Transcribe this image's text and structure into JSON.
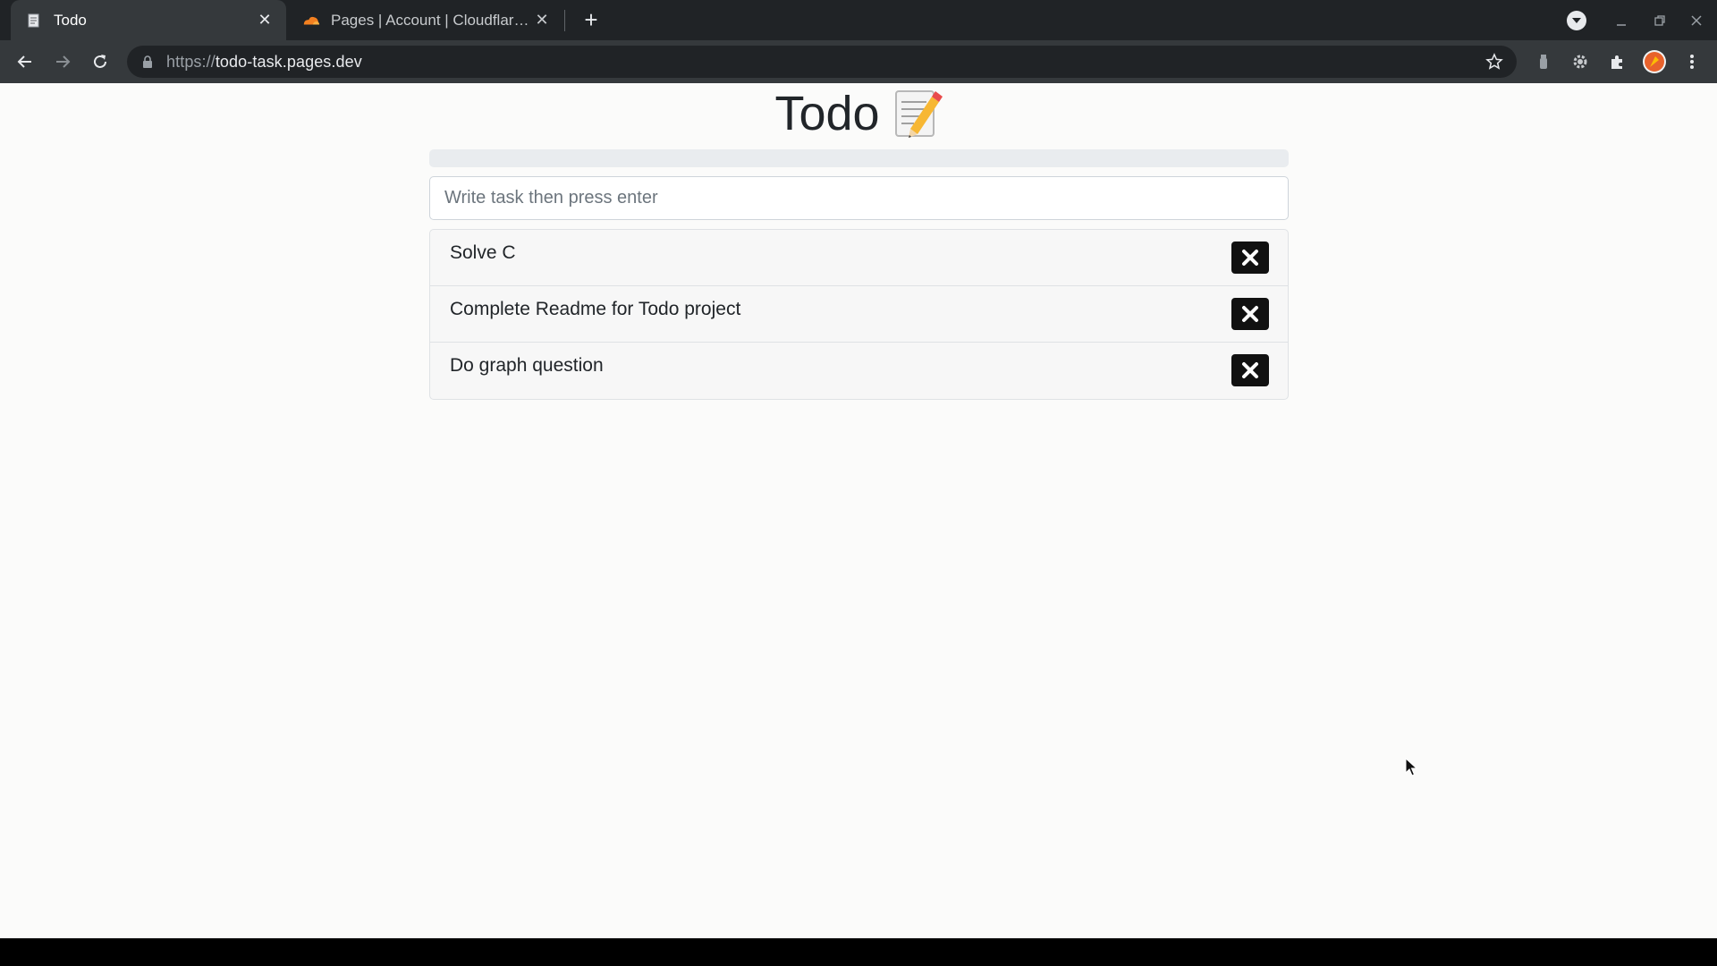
{
  "browser": {
    "tabs": [
      {
        "title": "Todo",
        "active": true,
        "favicon": "memo-icon"
      },
      {
        "title": "Pages | Account | Cloudflare -",
        "active": false,
        "favicon": "cloudflare-icon"
      }
    ],
    "url_scheme": "https://",
    "url_host": "todo-task.pages.dev"
  },
  "app": {
    "title": "Todo",
    "title_icon": "memo-pencil-icon",
    "progress_percent": 0,
    "input_placeholder": "Write task then press enter",
    "tasks": [
      {
        "text": "Solve C"
      },
      {
        "text": "Complete Readme for Todo project"
      },
      {
        "text": "Do graph question"
      }
    ]
  },
  "colors": {
    "page_bg": "#fbfbfa",
    "delete_button": "#111111",
    "chrome_dark": "#202326",
    "chrome_toolbar": "#35393c"
  }
}
